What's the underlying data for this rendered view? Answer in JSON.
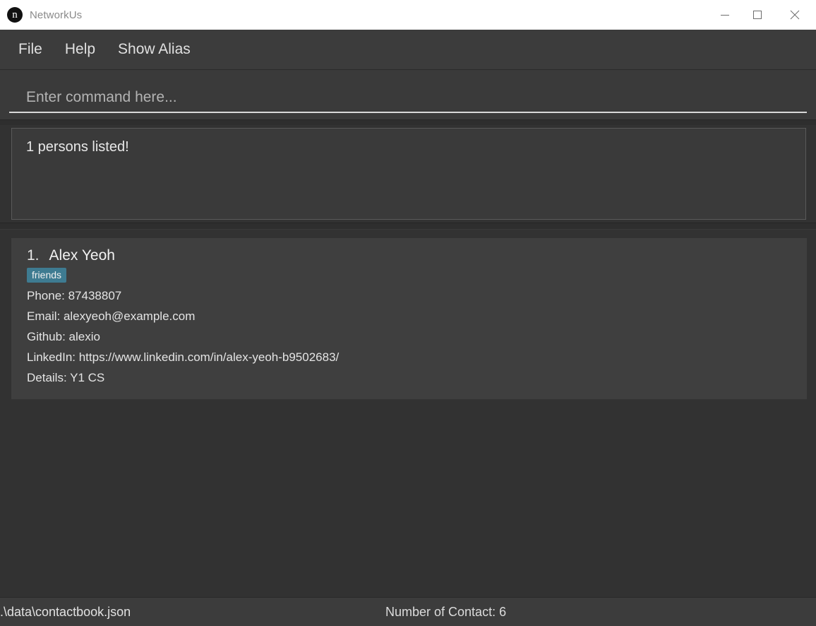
{
  "window": {
    "app_icon_glyph": "n",
    "title": "NetworkUs",
    "controls": {
      "minimize": "minimize-icon",
      "maximize": "maximize-icon",
      "close": "close-icon"
    }
  },
  "menubar": {
    "items": [
      {
        "label": "File"
      },
      {
        "label": "Help"
      },
      {
        "label": "Show Alias"
      }
    ]
  },
  "command": {
    "placeholder": "Enter command here...",
    "value": ""
  },
  "result": {
    "message": "1 persons listed!"
  },
  "list": {
    "persons": [
      {
        "index": "1.",
        "name": "Alex Yeoh",
        "tags": [
          "friends"
        ],
        "details": [
          "Phone: 87438807",
          "Email: alexyeoh@example.com",
          "Github: alexio",
          "LinkedIn: https://www.linkedin.com/in/alex-yeoh-b9502683/",
          "Details: Y1 CS"
        ]
      }
    ]
  },
  "statusbar": {
    "file_path": ".\\data\\contactbook.json",
    "contact_count": "Number of Contact: 6"
  },
  "colors": {
    "tag_accent": "#3e7b91",
    "window_chrome": "#ffffff",
    "app_background": "#323232",
    "panel_background": "#3a3a3a",
    "card_background": "#3f3f3f"
  }
}
